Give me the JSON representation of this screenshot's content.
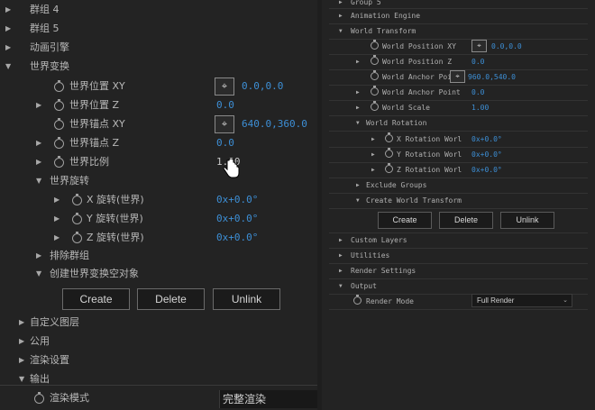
{
  "left": {
    "rows": [
      {
        "label": "群组 4",
        "tri": "▶"
      },
      {
        "label": "群组 5",
        "tri": "▶"
      },
      {
        "label": "动画引擎",
        "tri": "▶"
      },
      {
        "label": "世界变换",
        "tri": "▼"
      }
    ],
    "props": [
      {
        "label": "世界位置 XY",
        "value": "0.0,0.0",
        "target": "⌖"
      },
      {
        "label": "世界位置 Z",
        "value": "0.0",
        "tri": "▶"
      },
      {
        "label": "世界锚点 XY",
        "value": "640.0,360.0",
        "target": "⌖"
      },
      {
        "label": "世界锚点 Z",
        "value": "0.0",
        "tri": "▶"
      },
      {
        "label": "世界比例",
        "value": "1.00",
        "tri": "▶"
      }
    ],
    "world_rotation": {
      "label": "世界旋转",
      "tri": "▼"
    },
    "rotations": [
      {
        "label": "X 旋转(世界)",
        "value": "0x+0.0°"
      },
      {
        "label": "Y 旋转(世界)",
        "value": "0x+0.0°"
      },
      {
        "label": "Z 旋转(世界)",
        "value": "0x+0.0°"
      }
    ],
    "exclude_groups": {
      "label": "排除群组",
      "tri": "▶"
    },
    "create_null": {
      "label": "创建世界变换空对象",
      "tri": "▼"
    },
    "buttons": {
      "create": "Create",
      "delete": "Delete",
      "unlink": "Unlink"
    },
    "bottom_rows": [
      {
        "label": "自定义图层",
        "tri": "▶"
      },
      {
        "label": "公用",
        "tri": "▶"
      },
      {
        "label": "渲染设置",
        "tri": "▶"
      },
      {
        "label": "输出",
        "tri": "▼"
      }
    ],
    "render_mode": {
      "label": "渲染模式",
      "value": "完整渲染"
    }
  },
  "right": {
    "group5": {
      "label": "Group 5",
      "tri": "▶"
    },
    "animation_engine": {
      "label": "Animation Engine",
      "tri": "▶"
    },
    "world_transform": {
      "label": "World Transform",
      "tri": "▼"
    },
    "props": [
      {
        "label": "World Position XY",
        "value": "0.0,0.0",
        "target": "⌖"
      },
      {
        "label": "World Position Z",
        "value": "0.0",
        "tri": "▶"
      },
      {
        "label": "World Anchor Point",
        "value": "960.0,540.0",
        "target": "⌖"
      },
      {
        "label": "World Anchor Point",
        "value": "0.0",
        "tri": "▶"
      },
      {
        "label": "World Scale",
        "value": "1.00",
        "tri": "▶"
      }
    ],
    "world_rotation": {
      "label": "World Rotation",
      "tri": "▼"
    },
    "rotations": [
      {
        "label": "X Rotation Worl",
        "value": "0x+0.0°"
      },
      {
        "label": "Y Rotation Worl",
        "value": "0x+0.0°"
      },
      {
        "label": "Z Rotation Worl",
        "value": "0x+0.0°"
      }
    ],
    "exclude_groups": {
      "label": "Exclude Groups",
      "tri": "▶"
    },
    "create_transform": {
      "label": "Create World Transform",
      "tri": "▼"
    },
    "buttons": {
      "create": "Create",
      "delete": "Delete",
      "unlink": "Unlink"
    },
    "bottom_rows": [
      {
        "label": "Custom Layers",
        "tri": "▶"
      },
      {
        "label": "Utilities",
        "tri": "▶"
      },
      {
        "label": "Render Settings",
        "tri": "▶"
      },
      {
        "label": "Output",
        "tri": "▼"
      }
    ],
    "render_mode": {
      "label": "Render Mode",
      "value": "Full Render",
      "chevron": "⌄"
    }
  }
}
